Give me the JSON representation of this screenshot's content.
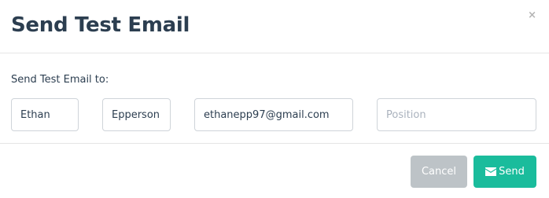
{
  "header": {
    "title": "Send Test Email",
    "close_label": "×"
  },
  "body": {
    "label": "Send Test Email to:",
    "first_name": {
      "value": "Ethan",
      "placeholder": ""
    },
    "last_name": {
      "value": "Epperson",
      "placeholder": ""
    },
    "email": {
      "value": "ethanepp97@gmail.com",
      "placeholder": ""
    },
    "position": {
      "value": "",
      "placeholder": "Position"
    }
  },
  "footer": {
    "cancel_label": "Cancel",
    "send_label": "Send",
    "send_icon": "envelope-icon"
  },
  "colors": {
    "title": "#2c3e50",
    "cancel_button": "#bdc3c7",
    "send_button": "#1abc9c",
    "border": "#cfd4d9"
  }
}
